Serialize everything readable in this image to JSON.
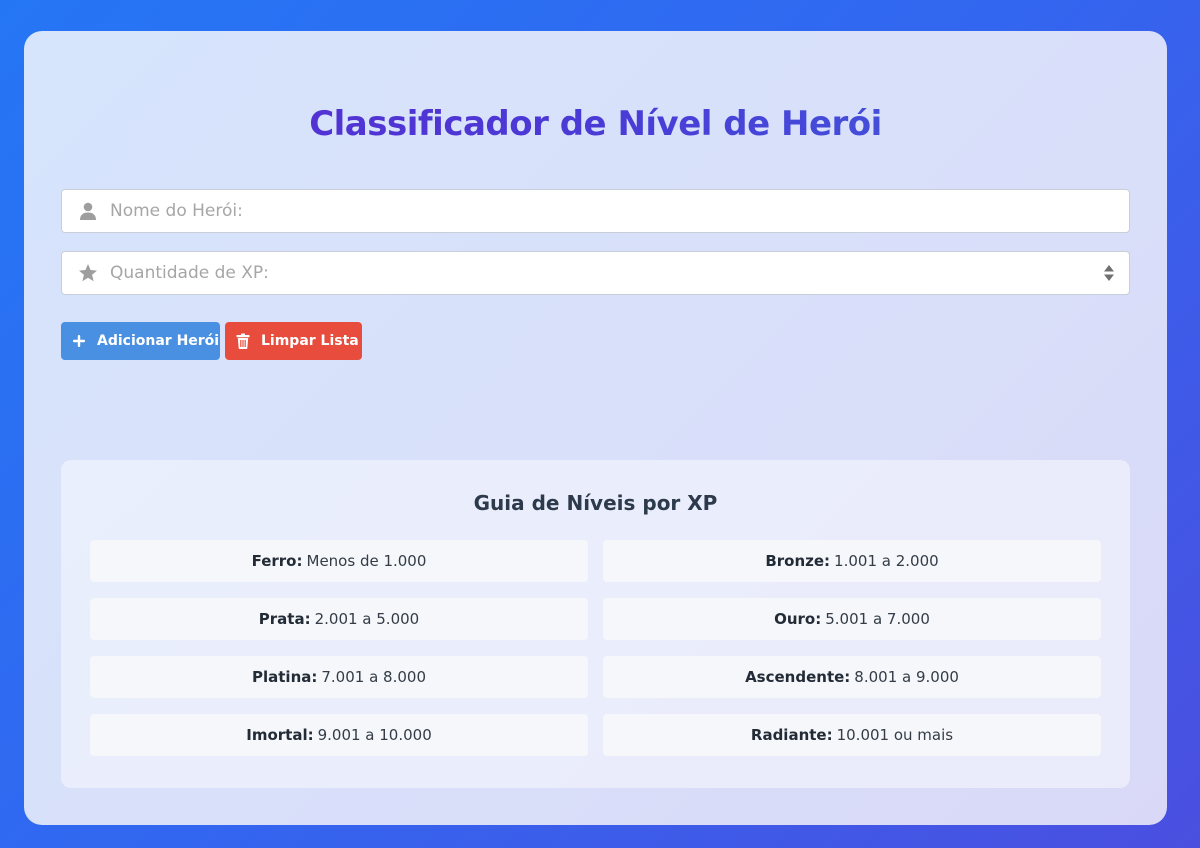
{
  "app": {
    "title": "Classificador de Nível de Herói"
  },
  "form": {
    "name_placeholder": "Nome do Herói:",
    "xp_placeholder": "Quantidade de XP:",
    "name_icon": "user-icon",
    "xp_icon": "star-icon"
  },
  "buttons": {
    "add_label": "Adicionar Herói",
    "clear_label": "Limpar Lista",
    "add_icon": "plus-icon",
    "clear_icon": "trash-icon"
  },
  "guide": {
    "title": "Guia de Níveis por XP",
    "tiers": [
      {
        "name": "Ferro:",
        "range": "Menos de 1.000"
      },
      {
        "name": "Bronze:",
        "range": "1.001 a 2.000"
      },
      {
        "name": "Prata:",
        "range": "2.001 a 5.000"
      },
      {
        "name": "Ouro:",
        "range": "5.001 a 7.000"
      },
      {
        "name": "Platina:",
        "range": "7.001 a 8.000"
      },
      {
        "name": "Ascendente:",
        "range": "8.001 a 9.000"
      },
      {
        "name": "Imortal:",
        "range": "9.001 a 10.000"
      },
      {
        "name": "Radiante:",
        "range": "10.001 ou mais"
      }
    ]
  },
  "colors": {
    "primary_button": "#4a90e2",
    "danger_button": "#e74c3c",
    "title_gradient_start": "#5a2bd0",
    "title_gradient_end": "#3d62dc"
  }
}
